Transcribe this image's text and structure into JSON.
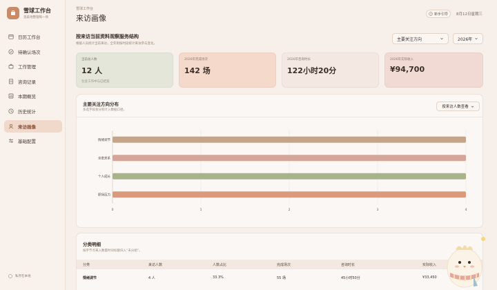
{
  "brand": {
    "title": "雪球工作台",
    "subtitle": "温柔地整理每一场"
  },
  "nav": [
    {
      "label": "日历工作台",
      "icon": "calendar-icon"
    },
    {
      "label": "待确认场次",
      "icon": "check-circle-icon"
    },
    {
      "label": "工作管理",
      "icon": "briefcase-icon"
    },
    {
      "label": "咨询记录",
      "icon": "notes-icon"
    },
    {
      "label": "本期概览",
      "icon": "overview-icon"
    },
    {
      "label": "历史统计",
      "icon": "history-icon"
    },
    {
      "label": "来访画像",
      "icon": "user-icon",
      "active": true
    },
    {
      "label": "基础配置",
      "icon": "sliders-icon"
    }
  ],
  "sidebar_footer": "私存在本地",
  "header": {
    "breadcrumb": "雪球工作台",
    "title": "来访画像",
    "help_label": "新手引导",
    "date": "8月12日星期三"
  },
  "section": {
    "title": "按来访当前资料观察服务结构",
    "description": "根据人员统计当前来访，全年则按时段统计来访参与变化。",
    "direction_select": "主要关注方向",
    "year_select": "2026年"
  },
  "stats": [
    {
      "label": "当前总人数",
      "value": "12 人",
      "sub": "包含工作中与已结案"
    },
    {
      "label": "2026年完成场次",
      "value": "142 场",
      "sub": ""
    },
    {
      "label": "2026年咨询时长",
      "value": "122小时20分",
      "sub": ""
    },
    {
      "label": "2026年实际收入",
      "value": "¥94,700",
      "sub": ""
    }
  ],
  "chart_panel": {
    "title": "主要关注方向分布",
    "description": "多选字段会分别计入数据口径。",
    "view_select": "按来访人数查看"
  },
  "chart_data": {
    "type": "bar",
    "orientation": "horizontal",
    "categories": [
      "情绪调节",
      "亲密关系",
      "个人成长",
      "职场压力"
    ],
    "values": [
      4,
      4,
      4,
      4
    ],
    "xlim": [
      0,
      4
    ],
    "xticks": [
      "0",
      "1",
      "2",
      "3",
      "4"
    ],
    "colors": [
      "#c4a589",
      "#d4a59a",
      "#a8b38a",
      "#dc9a7d"
    ],
    "grid": true
  },
  "table": {
    "title": "分类明细",
    "description": "按字节点来入数量时间标额归入“未分组”。",
    "columns": [
      "分类",
      "来访人数",
      "人数占比",
      "完成场次",
      "咨询时长",
      "实际收入"
    ],
    "rows": [
      [
        "情绪调节",
        "4 人",
        "33.3%",
        "55 场",
        "45小时50分",
        "¥33,450"
      ]
    ]
  },
  "colors": {
    "accent": "#c98a68",
    "active_bg": "#f0d9cb",
    "background": "#f7efe9"
  }
}
